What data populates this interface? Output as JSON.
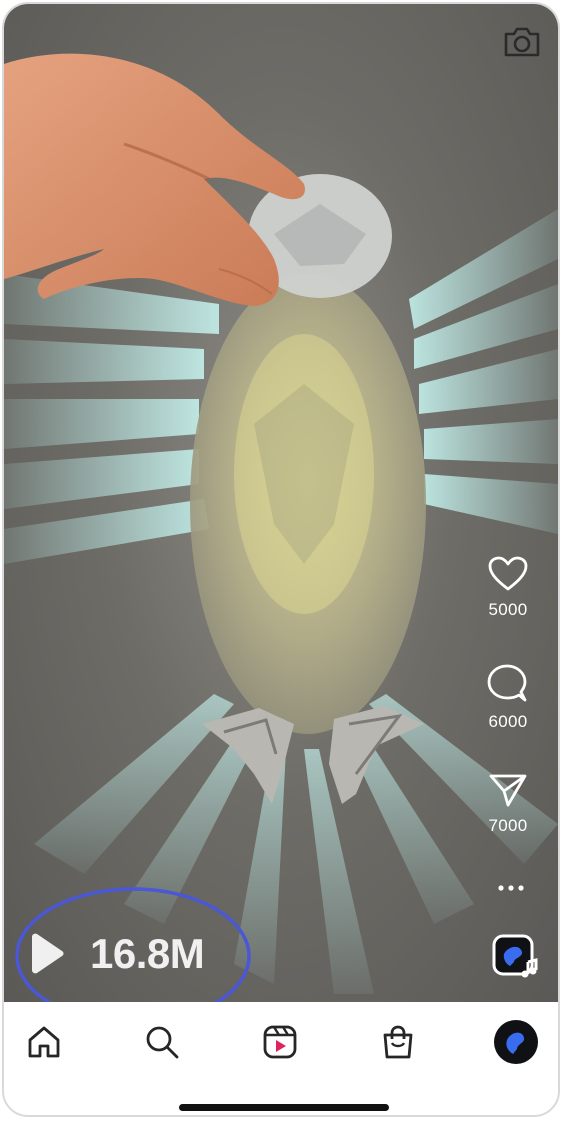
{
  "video": {
    "likes_count": "5000",
    "comments_count": "6000",
    "shares_count": "7000",
    "views_count": "16.8M"
  },
  "top_bar": {
    "camera_icon": "camera-icon"
  },
  "actions": [
    {
      "name": "like",
      "icon": "heart-icon"
    },
    {
      "name": "comment",
      "icon": "comment-icon"
    },
    {
      "name": "share",
      "icon": "paper-plane-icon"
    },
    {
      "name": "more",
      "icon": "more-dots-icon"
    },
    {
      "name": "audio",
      "icon": "original-audio-icon"
    }
  ],
  "bottom_nav": [
    {
      "name": "home",
      "icon": "home-icon"
    },
    {
      "name": "search",
      "icon": "search-icon"
    },
    {
      "name": "reels",
      "icon": "reels-icon"
    },
    {
      "name": "shop",
      "icon": "shopping-bag-icon"
    },
    {
      "name": "profile",
      "icon": "avatar"
    }
  ],
  "colors": {
    "highlight_ring": "#4a57d6",
    "glow": "#bff2ee",
    "text": "#ffffff",
    "nav_icon": "#262626",
    "avatar_bg": "#0f1115",
    "avatar_accent": "#3a6cf0"
  }
}
